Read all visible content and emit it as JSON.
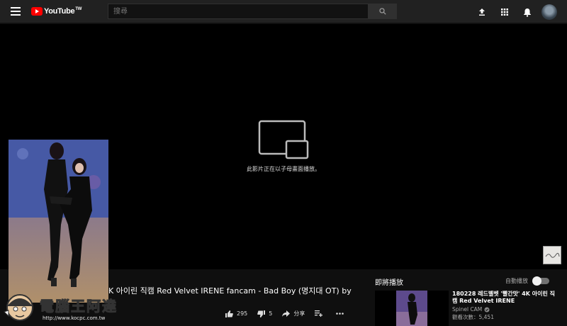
{
  "header": {
    "logo_text": "YouTube",
    "logo_sup": "TW",
    "search_placeholder": "搜尋",
    "icons": [
      "menu-icon",
      "search-icon",
      "upload-icon",
      "apps-icon",
      "bell-icon",
      "avatar"
    ]
  },
  "player": {
    "pip_message": "此影片正在以子母畫面播放。"
  },
  "video": {
    "title": "K 아이린 직캠 Red Velvet IRENE fancam - Bad Boy (명지대 OT) by",
    "likes": "295",
    "dislikes": "5",
    "share_label": "分享"
  },
  "sidebar": {
    "up_next_label": "即將播放",
    "autoplay_label": "自動播放",
    "autoplay_on": true,
    "recommendations": [
      {
        "title": "180228 레드벨벳 '빨간맛' 4K 아이린 직캠 Red Velvet IRENE",
        "channel": "Spinel CAM",
        "views": "觀看次數：5,451"
      }
    ]
  },
  "watermark": {
    "text": "電腦王阿達",
    "url": "http://www.kocpc.com.tw"
  },
  "colors": {
    "brand_red": "#ff0000",
    "bg": "#0f0f0f",
    "topbar": "#212121"
  }
}
